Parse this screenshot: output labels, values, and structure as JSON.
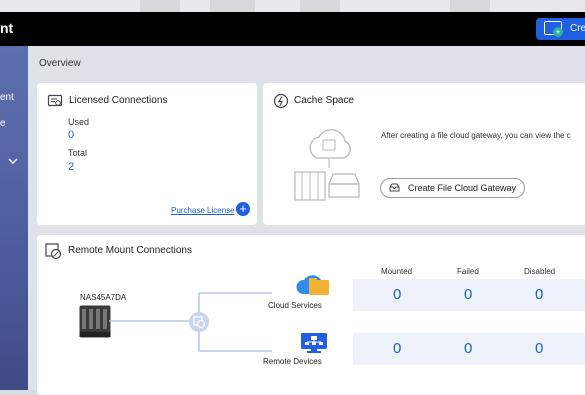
{
  "header": {
    "app_title": "nt",
    "create_label": "Cre"
  },
  "sidebar": {
    "items": [
      {
        "label": "ent"
      },
      {
        "label": "e"
      }
    ]
  },
  "overview_label": "Overview",
  "licensed": {
    "title": "Licensed Connections",
    "used_label": "Used",
    "used_value": "0",
    "total_label": "Total",
    "total_value": "2",
    "purchase_label": "Purchase License"
  },
  "cache": {
    "title": "Cache Space",
    "description": "After creating a file cloud gateway, you can view the c",
    "create_gateway_label": "Create File Cloud Gateway"
  },
  "remote": {
    "title": "Remote Mount Connections",
    "device_name": "NAS45A7DA",
    "columns": [
      "Mounted",
      "Failed",
      "Disabled"
    ],
    "rows": [
      {
        "label": "Cloud Services",
        "values": [
          "0",
          "0",
          "0"
        ]
      },
      {
        "label": "Remote Devices",
        "values": [
          "0",
          "0",
          "0"
        ]
      }
    ]
  },
  "colors": {
    "accent": "#1f5fe0",
    "value_blue": "#1f5fc8",
    "sidebar": "#5e6fb0"
  }
}
